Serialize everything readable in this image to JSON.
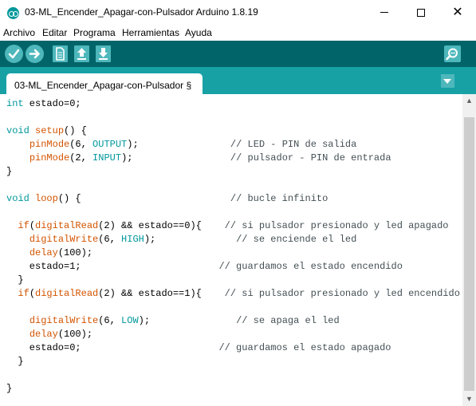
{
  "window": {
    "title": "03-ML_Encender_Apagar-con-Pulsador Arduino 1.8.19",
    "close_glyph": "✕"
  },
  "menu": [
    "Archivo",
    "Editar",
    "Programa",
    "Herramientas",
    "Ayuda"
  ],
  "toolbar": {
    "buttons": [
      "verify-icon",
      "upload-icon",
      "new-icon",
      "open-icon",
      "save-icon"
    ],
    "serial_monitor": "serial-monitor-icon"
  },
  "tab": {
    "label": "03-ML_Encender_Apagar-con-Pulsador §"
  },
  "colors": {
    "toolbar_bg": "#006468",
    "tabstrip_bg": "#17a1a5",
    "button_bg": "#4db7bb",
    "keyword": "#00979c",
    "function": "#d35400",
    "comment": "#434f54"
  },
  "code": [
    [
      [
        "int",
        "type"
      ],
      [
        " estado=0;",
        "text"
      ]
    ],
    [],
    [
      [
        "void",
        "type"
      ],
      [
        " ",
        "text"
      ],
      [
        "setup",
        "fn"
      ],
      [
        "() {",
        "text"
      ]
    ],
    [
      [
        "    ",
        "text"
      ],
      [
        "pinMode",
        "fn"
      ],
      [
        "(6, ",
        "text"
      ],
      [
        "OUTPUT",
        "const"
      ],
      [
        ");                // LED - PIN de salida",
        "comment_tail"
      ]
    ],
    [
      [
        "    ",
        "text"
      ],
      [
        "pinMode",
        "fn"
      ],
      [
        "(2, ",
        "text"
      ],
      [
        "INPUT",
        "const"
      ],
      [
        ");                 // pulsador - PIN de entrada",
        "comment_tail"
      ]
    ],
    [
      [
        "}",
        "text"
      ]
    ],
    [],
    [
      [
        "void",
        "type"
      ],
      [
        " ",
        "text"
      ],
      [
        "loop",
        "fn"
      ],
      [
        "() {",
        "text"
      ],
      [
        "                          // bucle infinito",
        "comment"
      ]
    ],
    [],
    [
      [
        "  ",
        "text"
      ],
      [
        "if",
        "fn"
      ],
      [
        "(",
        "text"
      ],
      [
        "digitalRead",
        "fn"
      ],
      [
        "(2) && estado==0){",
        "text"
      ],
      [
        "    // si pulsador presionado y led apagado",
        "comment"
      ]
    ],
    [
      [
        "    ",
        "text"
      ],
      [
        "digitalWrite",
        "fn"
      ],
      [
        "(6, ",
        "text"
      ],
      [
        "HIGH",
        "const"
      ],
      [
        ");",
        "text"
      ],
      [
        "              // se enciende el led",
        "comment"
      ]
    ],
    [
      [
        "    ",
        "text"
      ],
      [
        "delay",
        "fn"
      ],
      [
        "(100);",
        "text"
      ]
    ],
    [
      [
        "    estado=1;",
        "text"
      ],
      [
        "                        // guardamos el estado encendido",
        "comment"
      ]
    ],
    [
      [
        "  }",
        "text"
      ]
    ],
    [
      [
        "  ",
        "text"
      ],
      [
        "if",
        "fn"
      ],
      [
        "(",
        "text"
      ],
      [
        "digitalRead",
        "fn"
      ],
      [
        "(2) && estado==1){",
        "text"
      ],
      [
        "    // si pulsador presionado y led encendido",
        "comment"
      ]
    ],
    [],
    [
      [
        "    ",
        "text"
      ],
      [
        "digitalWrite",
        "fn"
      ],
      [
        "(6, ",
        "text"
      ],
      [
        "LOW",
        "const"
      ],
      [
        ");",
        "text"
      ],
      [
        "               // se apaga el led",
        "comment"
      ]
    ],
    [
      [
        "    ",
        "text"
      ],
      [
        "delay",
        "fn"
      ],
      [
        "(100);",
        "text"
      ]
    ],
    [
      [
        "    estado=0;",
        "text"
      ],
      [
        "                        // guardamos el estado apagado",
        "comment"
      ]
    ],
    [
      [
        "  }",
        "text"
      ]
    ],
    [],
    [
      [
        "}",
        "text"
      ]
    ]
  ]
}
